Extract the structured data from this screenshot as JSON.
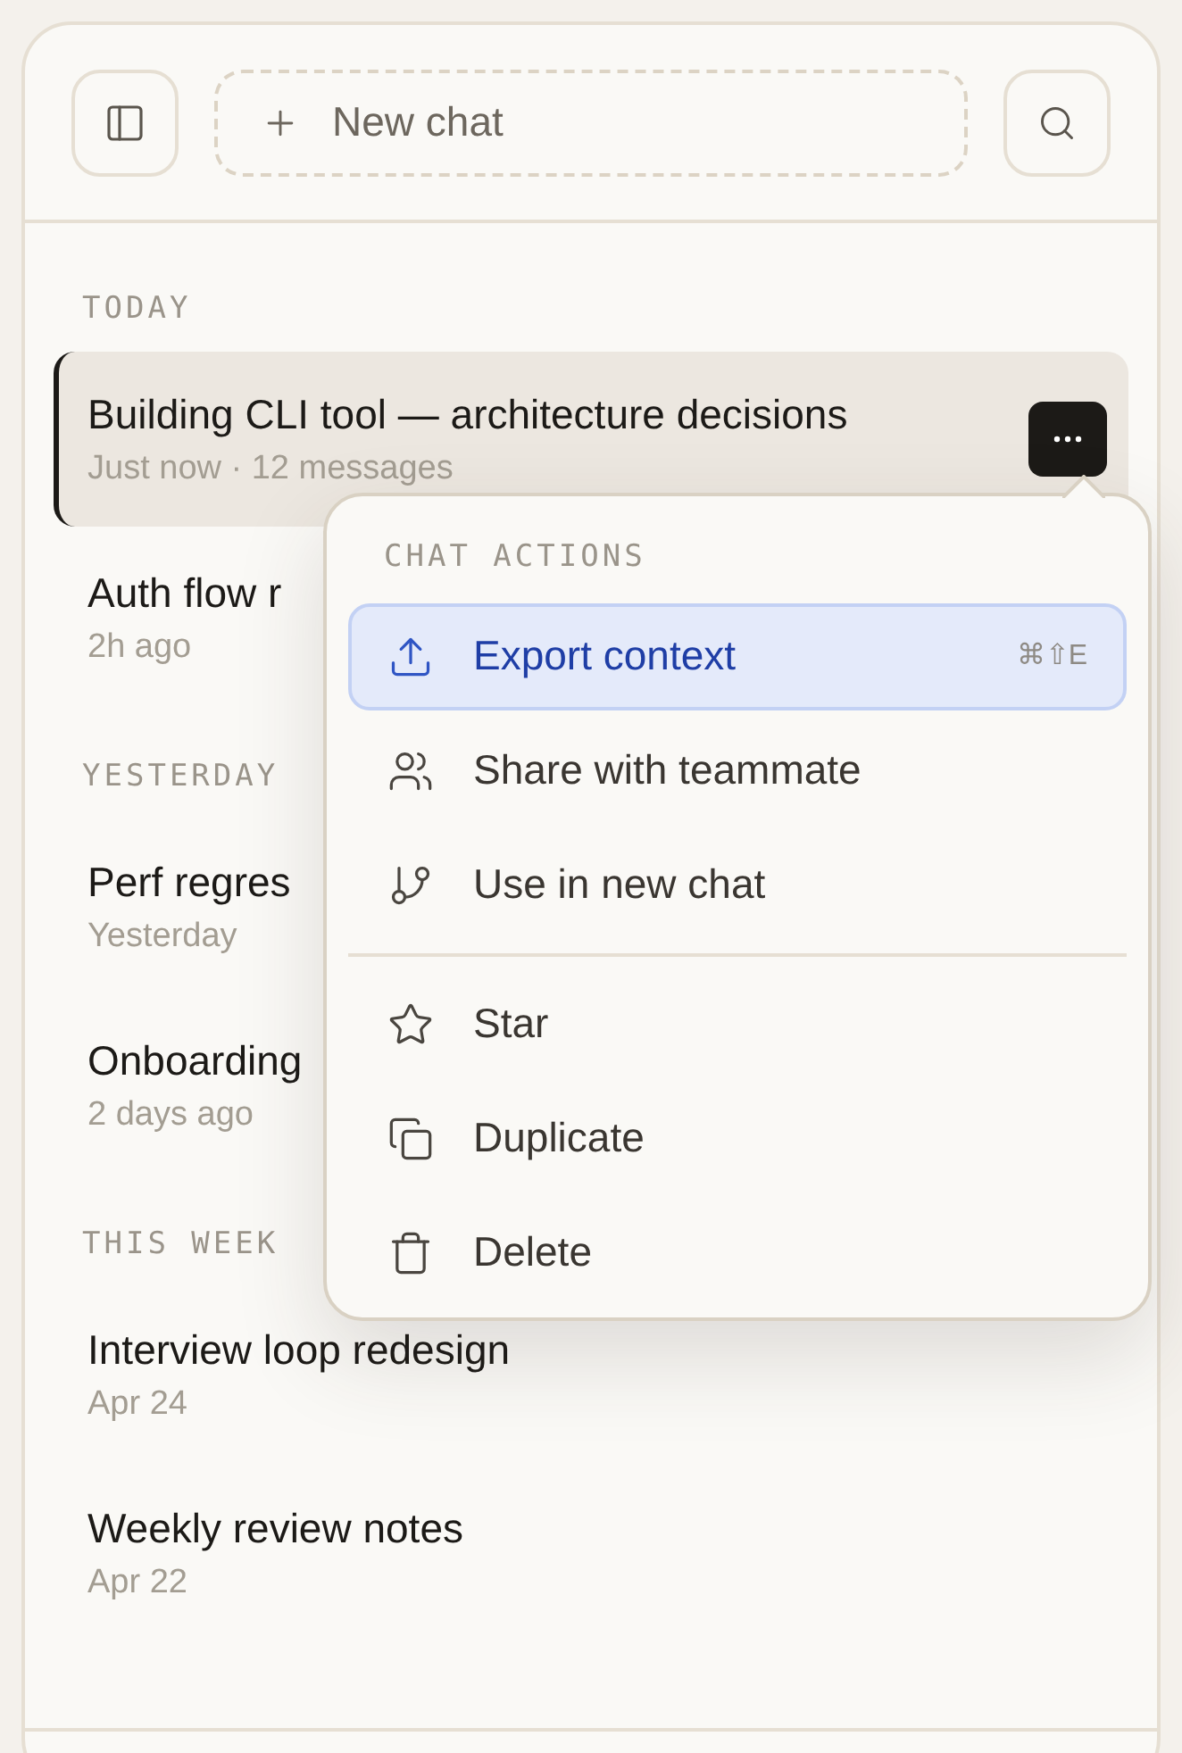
{
  "header": {
    "new_chat": {
      "label": "New chat"
    }
  },
  "sections": [
    {
      "label": "TODAY",
      "chats": [
        {
          "title": "Building CLI tool — architecture decisions",
          "meta": "Just now · 12 messages",
          "selected": true
        },
        {
          "title": "Auth flow r",
          "meta": "2h ago",
          "selected": false
        }
      ]
    },
    {
      "label": "YESTERDAY",
      "chats": [
        {
          "title": "Perf regres",
          "meta": "Yesterday",
          "selected": false
        },
        {
          "title": "Onboarding",
          "meta": "2 days ago",
          "selected": false
        }
      ]
    },
    {
      "label": "THIS WEEK",
      "chats": [
        {
          "title": "Interview loop redesign",
          "meta": "Apr 24",
          "selected": false
        },
        {
          "title": "Weekly review notes",
          "meta": "Apr 22",
          "selected": false
        }
      ]
    }
  ],
  "menu": {
    "title": "CHAT ACTIONS",
    "groups": [
      [
        {
          "label": "Export context",
          "shortcut": "⌘⇧E",
          "selected": true
        },
        {
          "label": "Share with teammate",
          "selected": false
        },
        {
          "label": "Use in new chat",
          "selected": false
        }
      ],
      [
        {
          "label": "Star",
          "selected": false
        },
        {
          "label": "Duplicate",
          "selected": false
        },
        {
          "label": "Delete",
          "selected": false
        }
      ]
    ]
  }
}
